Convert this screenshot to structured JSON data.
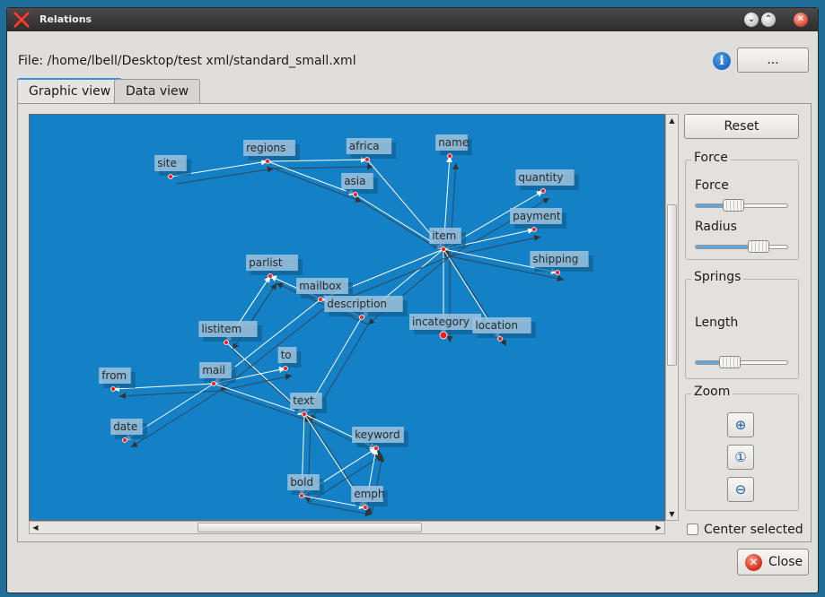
{
  "window": {
    "title": "Relations"
  },
  "file": {
    "label": "File:",
    "path": "/home/lbell/Desktop/test xml/standard_small.xml"
  },
  "browse_button": "...",
  "tabs": [
    {
      "label": "Graphic view",
      "active": true
    },
    {
      "label": "Data view",
      "active": false
    }
  ],
  "controls": {
    "reset": "Reset",
    "force_group": {
      "title": "Force",
      "force": {
        "label": "Force",
        "value": 0.41
      },
      "radius": {
        "label": "Radius",
        "value": 0.69
      }
    },
    "springs_group": {
      "title": "Springs",
      "length": {
        "label": "Length",
        "value": 0.37
      }
    },
    "zoom_group": {
      "title": "Zoom",
      "buttons": [
        "zoom-in-icon",
        "zoom-reset-icon",
        "zoom-out-icon"
      ]
    },
    "center_selected": {
      "label": "Center selected",
      "checked": false
    }
  },
  "close_button": "Close",
  "colors": {
    "graph_bg": "#1480c6",
    "node": "#ff1a1a",
    "label_bg": "#9fc3dd",
    "accent": "#3a8fd6"
  },
  "graph": {
    "nodes": [
      {
        "id": "site",
        "label": "site"
      },
      {
        "id": "regions",
        "label": "regions"
      },
      {
        "id": "africa",
        "label": "africa"
      },
      {
        "id": "asia",
        "label": "asia"
      },
      {
        "id": "name",
        "label": "name"
      },
      {
        "id": "quantity",
        "label": "quantity"
      },
      {
        "id": "payment",
        "label": "payment"
      },
      {
        "id": "item",
        "label": "item"
      },
      {
        "id": "shipping",
        "label": "shipping"
      },
      {
        "id": "parlist",
        "label": "parlist"
      },
      {
        "id": "mailbox",
        "label": "mailbox"
      },
      {
        "id": "description",
        "label": "description"
      },
      {
        "id": "incategory",
        "label": "incategory"
      },
      {
        "id": "location",
        "label": "location"
      },
      {
        "id": "listitem",
        "label": "listitem"
      },
      {
        "id": "to",
        "label": "to"
      },
      {
        "id": "from",
        "label": "from"
      },
      {
        "id": "mail",
        "label": "mail"
      },
      {
        "id": "text",
        "label": "text"
      },
      {
        "id": "date",
        "label": "date"
      },
      {
        "id": "keyword",
        "label": "keyword"
      },
      {
        "id": "bold",
        "label": "bold"
      },
      {
        "id": "emph",
        "label": "emph"
      }
    ],
    "edges": [
      [
        "site",
        "regions"
      ],
      [
        "regions",
        "africa"
      ],
      [
        "regions",
        "asia"
      ],
      [
        "africa",
        "item"
      ],
      [
        "asia",
        "item"
      ],
      [
        "item",
        "name"
      ],
      [
        "item",
        "quantity"
      ],
      [
        "item",
        "payment"
      ],
      [
        "item",
        "shipping"
      ],
      [
        "item",
        "incategory"
      ],
      [
        "item",
        "location"
      ],
      [
        "item",
        "description"
      ],
      [
        "item",
        "mailbox"
      ],
      [
        "description",
        "parlist"
      ],
      [
        "description",
        "text"
      ],
      [
        "parlist",
        "listitem"
      ],
      [
        "listitem",
        "text"
      ],
      [
        "mailbox",
        "mail"
      ],
      [
        "mail",
        "from"
      ],
      [
        "mail",
        "to"
      ],
      [
        "mail",
        "date"
      ],
      [
        "mail",
        "text"
      ],
      [
        "text",
        "keyword"
      ],
      [
        "text",
        "bold"
      ],
      [
        "text",
        "emph"
      ],
      [
        "bold",
        "keyword"
      ],
      [
        "emph",
        "keyword"
      ],
      [
        "bold",
        "emph"
      ],
      [
        "listitem",
        "parlist"
      ]
    ]
  }
}
